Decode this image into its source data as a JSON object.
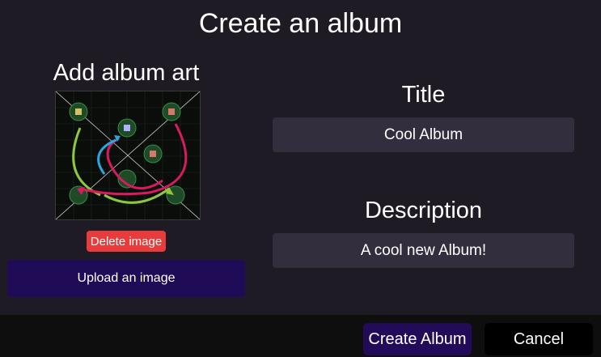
{
  "dialog": {
    "title": "Create an album"
  },
  "album_art": {
    "heading": "Add album art",
    "delete_label": "Delete image",
    "upload_label": "Upload an image"
  },
  "fields": {
    "title_label": "Title",
    "title_value": "Cool Album",
    "description_label": "Description",
    "description_value": "A cool new Album!"
  },
  "footer": {
    "create_label": "Create Album",
    "cancel_label": "Cancel"
  },
  "colors": {
    "background": "#1e1b24",
    "input_bg": "#322e3d",
    "delete_button": "#e83b3b",
    "primary_button": "#1f0b56",
    "footer_bg": "#0e0e0e"
  }
}
